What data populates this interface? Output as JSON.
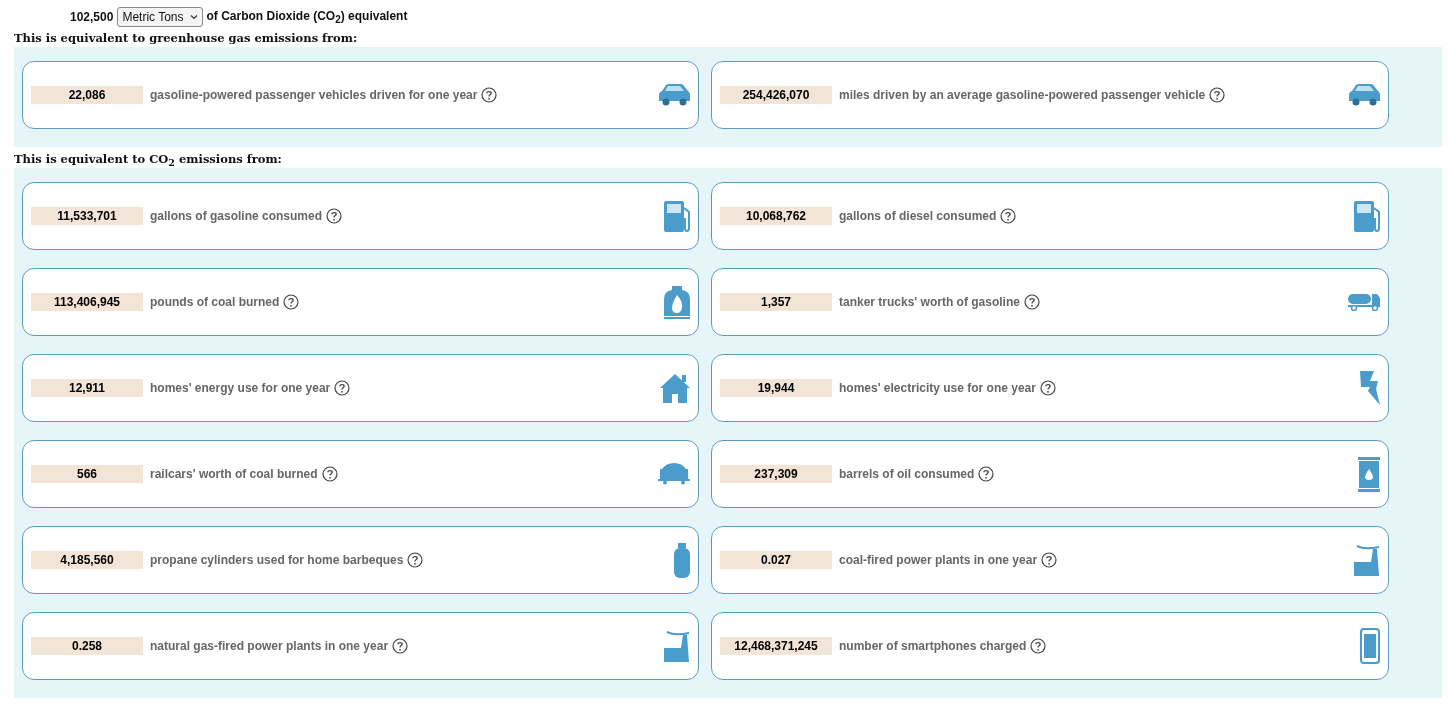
{
  "input": {
    "amount": "102,500",
    "unit": "Metric Tons",
    "suffix": "of Carbon Dioxide (CO$_{2}$) equivalent"
  },
  "sections": [
    {
      "heading": "This is equivalent to greenhouse gas emissions from:",
      "rows": [
        [
          {
            "amount": "22,086",
            "description": "gasoline-powered passenger vehicles driven for one year",
            "kind": "car"
          },
          {
            "amount": "254,426,070",
            "description": "miles driven by an average gasoline-powered passenger vehicle",
            "kind": "car"
          }
        ]
      ]
    },
    {
      "heading": "This is equivalent to CO$_{2}$ emissions from:",
      "rows": [
        [
          {
            "amount": "11,533,701",
            "description": "gallons of gasoline consumed",
            "kind": "pump"
          },
          {
            "amount": "10,068,762",
            "description": "gallons of diesel consumed",
            "kind": "pump"
          }
        ],
        [
          {
            "amount": "113,406,945",
            "description": "pounds of coal burned",
            "kind": "furnace"
          },
          {
            "amount": "1,357",
            "description": "tanker trucks' worth of gasoline",
            "kind": "truck"
          }
        ],
        [
          {
            "amount": "12,911",
            "description": "homes' energy use for one year",
            "kind": "house"
          },
          {
            "amount": "19,944",
            "description": "homes' electricity use for one year",
            "kind": "bolt"
          }
        ],
        [
          {
            "amount": "566",
            "description": "railcars' worth of coal burned",
            "kind": "railcar"
          },
          {
            "amount": "237,309",
            "description": "barrels of oil consumed",
            "kind": "barrel"
          }
        ],
        [
          {
            "amount": "4,185,560",
            "description": "propane cylinders used for home barbeques",
            "kind": "cylinder"
          },
          {
            "amount": "0.027",
            "description": "coal-fired power plants in one year",
            "kind": "factory"
          }
        ],
        [
          {
            "amount": "0.258",
            "description": "natural gas-fired power plants in one year",
            "kind": "factory"
          },
          {
            "amount": "12,468,371,245",
            "description": "number of smartphones charged",
            "kind": "phone"
          }
        ]
      ]
    }
  ]
}
